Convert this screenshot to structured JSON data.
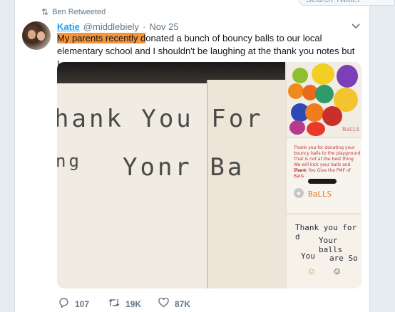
{
  "search": {
    "placeholder": "Search Twitter"
  },
  "retweet": {
    "label": "Ben Retweeted"
  },
  "tweet": {
    "name": "Katie",
    "handle": "@middlebiely",
    "separator": "·",
    "date": "Nov 25",
    "text_highlight": "My parents recently d",
    "text_rest": "onated a bunch of bouncy balls to our local elementary school and I shouldn't be laughing at the thank you notes but I am",
    "highlight_color": "#f4933a"
  },
  "media": {
    "main_line1": "hank You  For",
    "main_line2a": "ng",
    "main_line2b": "Yonr  Ba",
    "thumb1_label": "BaLLS",
    "thumb2_lines": [
      "Thank you for donating your",
      "bouncy balls to the playground",
      "That is not at the best thing",
      "We will kick your balls and share",
      "Thank You Give the PMF of Balls"
    ],
    "thumb2_label": "BaLLS",
    "thumb3_line1": "Thank you for d",
    "thumb3_line2": "Your balls",
    "thumb3_line3a": "You",
    "thumb3_line3b": "are So"
  },
  "actions": {
    "replies": "107",
    "retweets": "19K",
    "likes": "87K"
  }
}
